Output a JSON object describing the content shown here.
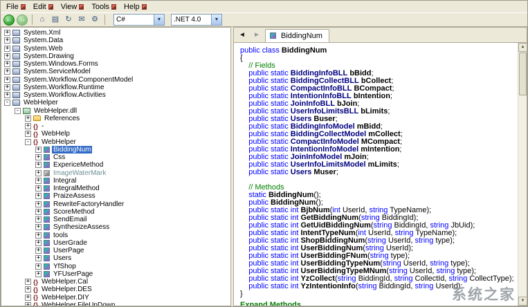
{
  "colors": {
    "sel": "#316ac5",
    "kw": "#0000ff",
    "type": "#000080",
    "comment": "#008000",
    "link": "#067d06"
  },
  "menu_bar": {
    "items": [
      "File",
      "Edit",
      "View",
      "Tools",
      "Help"
    ]
  },
  "toolbar": {
    "nav": [
      {
        "name": "back-button",
        "glyph": "←"
      },
      {
        "name": "forward-button",
        "glyph": "→"
      }
    ],
    "icons": [
      {
        "name": "home-icon",
        "glyph": "⌂"
      },
      {
        "name": "list-view-icon",
        "glyph": "▤"
      },
      {
        "name": "refresh-icon",
        "glyph": "↻"
      },
      {
        "name": "mail-icon",
        "glyph": "✉"
      },
      {
        "name": "settings-icon",
        "glyph": "⚙"
      }
    ],
    "language_combo": {
      "value": "C#"
    },
    "framework_combo": {
      "value": ".NET 4.0"
    }
  },
  "tree": {
    "items": [
      {
        "label": "System.Xml",
        "depth": 0,
        "exp": "plus",
        "icon": "assembly"
      },
      {
        "label": "System.Data",
        "depth": 0,
        "exp": "plus",
        "icon": "assembly"
      },
      {
        "label": "System.Web",
        "depth": 0,
        "exp": "plus",
        "icon": "assembly"
      },
      {
        "label": "System.Drawing",
        "depth": 0,
        "exp": "plus",
        "icon": "assembly"
      },
      {
        "label": "System.Windows.Forms",
        "depth": 0,
        "exp": "plus",
        "icon": "assembly"
      },
      {
        "label": "System.ServiceModel",
        "depth": 0,
        "exp": "plus",
        "icon": "assembly"
      },
      {
        "label": "System.Workflow.ComponentModel",
        "depth": 0,
        "exp": "plus",
        "icon": "assembly"
      },
      {
        "label": "System.Workflow.Runtime",
        "depth": 0,
        "exp": "plus",
        "icon": "assembly"
      },
      {
        "label": "System.Workflow.Activities",
        "depth": 0,
        "exp": "plus",
        "icon": "assembly"
      },
      {
        "label": "WebHelper",
        "depth": 0,
        "exp": "minus",
        "icon": "assembly"
      },
      {
        "label": "WebHelper.dll",
        "depth": 1,
        "exp": "minus",
        "icon": "dll"
      },
      {
        "label": "References",
        "depth": 2,
        "exp": "plus",
        "icon": "ref"
      },
      {
        "label": "-",
        "depth": 2,
        "exp": "plus",
        "icon": "ns"
      },
      {
        "label": "WebHelp",
        "depth": 2,
        "exp": "plus",
        "icon": "ns"
      },
      {
        "label": "WebHelper",
        "depth": 2,
        "exp": "minus",
        "icon": "ns"
      },
      {
        "label": "BiddingNum",
        "depth": 3,
        "exp": "plus",
        "icon": "cls",
        "sel": true
      },
      {
        "label": "Css",
        "depth": 3,
        "exp": "plus",
        "icon": "cls"
      },
      {
        "label": "ExpericeMethod",
        "depth": 3,
        "exp": "plus",
        "icon": "cls"
      },
      {
        "label": "ImageWaterMark",
        "depth": 3,
        "exp": "plus",
        "icon": "clsg"
      },
      {
        "label": "Integral",
        "depth": 3,
        "exp": "plus",
        "icon": "cls"
      },
      {
        "label": "IntegralMethod",
        "depth": 3,
        "exp": "plus",
        "icon": "cls"
      },
      {
        "label": "PraizeAssess",
        "depth": 3,
        "exp": "plus",
        "icon": "cls"
      },
      {
        "label": "RewriteFactoryHandler",
        "depth": 3,
        "exp": "plus",
        "icon": "cls"
      },
      {
        "label": "ScoreMethod",
        "depth": 3,
        "exp": "plus",
        "icon": "cls"
      },
      {
        "label": "SendEmail",
        "depth": 3,
        "exp": "plus",
        "icon": "cls"
      },
      {
        "label": "SynthesizeAssess",
        "depth": 3,
        "exp": "plus",
        "icon": "cls"
      },
      {
        "label": "tools",
        "depth": 3,
        "exp": "plus",
        "icon": "cls"
      },
      {
        "label": "UserGrade",
        "depth": 3,
        "exp": "plus",
        "icon": "cls"
      },
      {
        "label": "UserPage",
        "depth": 3,
        "exp": "plus",
        "icon": "cls"
      },
      {
        "label": "Users",
        "depth": 3,
        "exp": "plus",
        "icon": "cls"
      },
      {
        "label": "YfShop",
        "depth": 3,
        "exp": "plus",
        "icon": "cls"
      },
      {
        "label": "YFUserPage",
        "depth": 3,
        "exp": "plus",
        "icon": "cls"
      },
      {
        "label": "WebHelper.Cal",
        "depth": 2,
        "exp": "plus",
        "icon": "ns"
      },
      {
        "label": "WebHelper.DES",
        "depth": 2,
        "exp": "plus",
        "icon": "ns"
      },
      {
        "label": "WebHelper.DIY",
        "depth": 2,
        "exp": "plus",
        "icon": "ns"
      },
      {
        "label": "WebHelper.FileUpDown",
        "depth": 2,
        "exp": "plus",
        "icon": "ns"
      }
    ]
  },
  "tab_bar": {
    "active_tab": "BiddingNum"
  },
  "code": {
    "lines": [
      [
        [
          "k",
          "public class "
        ],
        [
          "d",
          "BiddingNum"
        ]
      ],
      [
        [
          "p",
          "{"
        ]
      ],
      [
        [
          "c",
          "    // Fields"
        ]
      ],
      [
        [
          "p",
          "    "
        ],
        [
          "k",
          "public static "
        ],
        [
          "t",
          "BiddingInfoBLL"
        ],
        [
          "p",
          " "
        ],
        [
          "d",
          "bBidd"
        ],
        [
          "p",
          ";"
        ]
      ],
      [
        [
          "p",
          "    "
        ],
        [
          "k",
          "public static "
        ],
        [
          "t",
          "BiddingCollectBLL"
        ],
        [
          "p",
          " "
        ],
        [
          "d",
          "bCollect"
        ],
        [
          "p",
          ";"
        ]
      ],
      [
        [
          "p",
          "    "
        ],
        [
          "k",
          "public static "
        ],
        [
          "t",
          "CompactInfoBLL"
        ],
        [
          "p",
          " "
        ],
        [
          "d",
          "BCompact"
        ],
        [
          "p",
          ";"
        ]
      ],
      [
        [
          "p",
          "    "
        ],
        [
          "k",
          "public static "
        ],
        [
          "t",
          "IntentionInfoBLL"
        ],
        [
          "p",
          " "
        ],
        [
          "d",
          "bIntention"
        ],
        [
          "p",
          ";"
        ]
      ],
      [
        [
          "p",
          "    "
        ],
        [
          "k",
          "public static "
        ],
        [
          "t",
          "JoinInfoBLL"
        ],
        [
          "p",
          " "
        ],
        [
          "d",
          "bJoin"
        ],
        [
          "p",
          ";"
        ]
      ],
      [
        [
          "p",
          "    "
        ],
        [
          "k",
          "public static "
        ],
        [
          "t",
          "UserInfoLimitsBLL"
        ],
        [
          "p",
          " "
        ],
        [
          "d",
          "bLimits"
        ],
        [
          "p",
          ";"
        ]
      ],
      [
        [
          "p",
          "    "
        ],
        [
          "k",
          "public static "
        ],
        [
          "t",
          "Users"
        ],
        [
          "p",
          " "
        ],
        [
          "d",
          "Buser"
        ],
        [
          "p",
          ";"
        ]
      ],
      [
        [
          "p",
          "    "
        ],
        [
          "k",
          "public static "
        ],
        [
          "t",
          "BiddingInfoModel"
        ],
        [
          "p",
          " "
        ],
        [
          "d",
          "mBidd"
        ],
        [
          "p",
          ";"
        ]
      ],
      [
        [
          "p",
          "    "
        ],
        [
          "k",
          "public static "
        ],
        [
          "t",
          "BiddingCollectModel"
        ],
        [
          "p",
          " "
        ],
        [
          "d",
          "mCollect"
        ],
        [
          "p",
          ";"
        ]
      ],
      [
        [
          "p",
          "    "
        ],
        [
          "k",
          "public static "
        ],
        [
          "t",
          "CompactInfoModel"
        ],
        [
          "p",
          " "
        ],
        [
          "d",
          "MCompact"
        ],
        [
          "p",
          ";"
        ]
      ],
      [
        [
          "p",
          "    "
        ],
        [
          "k",
          "public static "
        ],
        [
          "t",
          "IntentionInfoModel"
        ],
        [
          "p",
          " "
        ],
        [
          "d",
          "mIntention"
        ],
        [
          "p",
          ";"
        ]
      ],
      [
        [
          "p",
          "    "
        ],
        [
          "k",
          "public static "
        ],
        [
          "t",
          "JoinInfoModel"
        ],
        [
          "p",
          " "
        ],
        [
          "d",
          "mJoin"
        ],
        [
          "p",
          ";"
        ]
      ],
      [
        [
          "p",
          "    "
        ],
        [
          "k",
          "public static "
        ],
        [
          "t",
          "UserInfoLimitsModel"
        ],
        [
          "p",
          " "
        ],
        [
          "d",
          "mLimits"
        ],
        [
          "p",
          ";"
        ]
      ],
      [
        [
          "p",
          "    "
        ],
        [
          "k",
          "public static "
        ],
        [
          "t",
          "Users"
        ],
        [
          "p",
          " "
        ],
        [
          "d",
          "Muser"
        ],
        [
          "p",
          ";"
        ]
      ],
      [],
      [
        [
          "c",
          "    // Methods"
        ]
      ],
      [
        [
          "p",
          "    "
        ],
        [
          "k",
          "static "
        ],
        [
          "d",
          "BiddingNum"
        ],
        [
          "p",
          "();"
        ]
      ],
      [
        [
          "p",
          "    "
        ],
        [
          "k",
          "public "
        ],
        [
          "d",
          "BiddingNum"
        ],
        [
          "p",
          "();"
        ]
      ],
      [
        [
          "p",
          "    "
        ],
        [
          "k",
          "public static int "
        ],
        [
          "d",
          "BjbNum"
        ],
        [
          "p",
          "("
        ],
        [
          "k",
          "int"
        ],
        [
          "p",
          " UserId, "
        ],
        [
          "k",
          "string"
        ],
        [
          "p",
          " TypeName);"
        ]
      ],
      [
        [
          "p",
          "    "
        ],
        [
          "k",
          "public static int "
        ],
        [
          "d",
          "GetBiddingNum"
        ],
        [
          "p",
          "("
        ],
        [
          "k",
          "string"
        ],
        [
          "p",
          " BiddingId);"
        ]
      ],
      [
        [
          "p",
          "    "
        ],
        [
          "k",
          "public static int "
        ],
        [
          "d",
          "GetUidBiddingNum"
        ],
        [
          "p",
          "("
        ],
        [
          "k",
          "string"
        ],
        [
          "p",
          " BiddingId, "
        ],
        [
          "k",
          "string"
        ],
        [
          "p",
          " JbUid);"
        ]
      ],
      [
        [
          "p",
          "    "
        ],
        [
          "k",
          "public static int "
        ],
        [
          "d",
          "IntentTypeNum"
        ],
        [
          "p",
          "("
        ],
        [
          "k",
          "int"
        ],
        [
          "p",
          " UserId, "
        ],
        [
          "k",
          "string"
        ],
        [
          "p",
          " TypeName);"
        ]
      ],
      [
        [
          "p",
          "    "
        ],
        [
          "k",
          "public static int "
        ],
        [
          "d",
          "ShopBiddingNum"
        ],
        [
          "p",
          "("
        ],
        [
          "k",
          "string"
        ],
        [
          "p",
          " UserId, "
        ],
        [
          "k",
          "string"
        ],
        [
          "p",
          " type);"
        ]
      ],
      [
        [
          "p",
          "    "
        ],
        [
          "k",
          "public static int "
        ],
        [
          "d",
          "UserBiddingNum"
        ],
        [
          "p",
          "("
        ],
        [
          "k",
          "string"
        ],
        [
          "p",
          " UserId);"
        ]
      ],
      [
        [
          "p",
          "    "
        ],
        [
          "k",
          "public static int "
        ],
        [
          "d",
          "UserBiddingFNum"
        ],
        [
          "p",
          "("
        ],
        [
          "k",
          "string"
        ],
        [
          "p",
          " type);"
        ]
      ],
      [
        [
          "p",
          "    "
        ],
        [
          "k",
          "public static int "
        ],
        [
          "d",
          "UserBiddingTypeNum"
        ],
        [
          "p",
          "("
        ],
        [
          "k",
          "string"
        ],
        [
          "p",
          " UserId, "
        ],
        [
          "k",
          "string"
        ],
        [
          "p",
          " type);"
        ]
      ],
      [
        [
          "p",
          "    "
        ],
        [
          "k",
          "public static int "
        ],
        [
          "d",
          "UserBiddingTypeMNum"
        ],
        [
          "p",
          "("
        ],
        [
          "k",
          "string"
        ],
        [
          "p",
          " UserId, "
        ],
        [
          "k",
          "string"
        ],
        [
          "p",
          " type);"
        ]
      ],
      [
        [
          "p",
          "    "
        ],
        [
          "k",
          "public static int "
        ],
        [
          "d",
          "YzCollect"
        ],
        [
          "p",
          "("
        ],
        [
          "k",
          "string"
        ],
        [
          "p",
          " BiddingId, "
        ],
        [
          "k",
          "string"
        ],
        [
          "p",
          " CollectId, "
        ],
        [
          "k",
          "string"
        ],
        [
          "p",
          " CollectType);"
        ]
      ],
      [
        [
          "p",
          "    "
        ],
        [
          "k",
          "public static int "
        ],
        [
          "d",
          "YzIntentionInfo"
        ],
        [
          "p",
          "("
        ],
        [
          "k",
          "string"
        ],
        [
          "p",
          " BiddingId, "
        ],
        [
          "k",
          "string"
        ],
        [
          "p",
          " UserId);"
        ]
      ],
      [
        [
          "p",
          "}"
        ]
      ]
    ],
    "expand_link": "Expand Methods"
  },
  "watermark": "系统之家"
}
